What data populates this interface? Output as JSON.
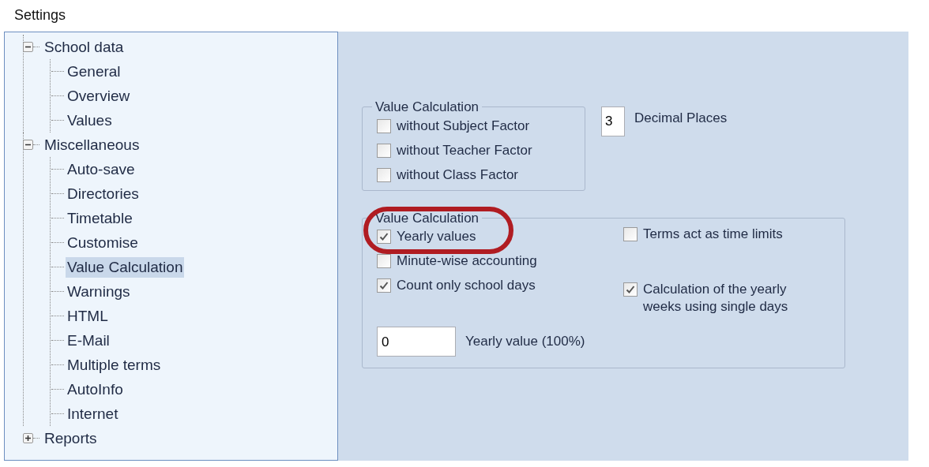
{
  "window": {
    "title": "Settings"
  },
  "tree": [
    {
      "label": "School data",
      "expanded": true,
      "selected": false,
      "children": [
        {
          "label": "General",
          "selected": false
        },
        {
          "label": "Overview",
          "selected": false
        },
        {
          "label": "Values",
          "selected": false
        }
      ]
    },
    {
      "label": "Miscellaneous",
      "expanded": true,
      "selected": false,
      "children": [
        {
          "label": "Auto-save",
          "selected": false
        },
        {
          "label": "Directories",
          "selected": false
        },
        {
          "label": "Timetable",
          "selected": false
        },
        {
          "label": "Customise",
          "selected": false
        },
        {
          "label": "Value Calculation",
          "selected": true
        },
        {
          "label": "Warnings",
          "selected": false
        },
        {
          "label": "HTML",
          "selected": false
        },
        {
          "label": "E-Mail",
          "selected": false
        },
        {
          "label": "Multiple terms",
          "selected": false
        },
        {
          "label": "AutoInfo",
          "selected": false
        },
        {
          "label": "Internet",
          "selected": false
        }
      ]
    },
    {
      "label": "Reports",
      "expanded": false,
      "selected": false
    }
  ],
  "factors_group": {
    "title": "Value Calculation",
    "options": [
      {
        "label": "without Subject Factor",
        "checked": false
      },
      {
        "label": "without Teacher Factor",
        "checked": false
      },
      {
        "label": "without Class Factor",
        "checked": false
      }
    ]
  },
  "decimal_places": {
    "value": "3",
    "label": "Decimal Places"
  },
  "values_group": {
    "title": "Value Calculation",
    "left_options": [
      {
        "label": "Yearly values",
        "checked": true,
        "highlighted": true
      },
      {
        "label": "Minute-wise accounting",
        "checked": false,
        "highlighted": false
      },
      {
        "label": "Count only school days",
        "checked": true,
        "highlighted": false
      }
    ],
    "right_options": [
      {
        "label": "Terms act as time limits",
        "checked": false
      },
      {
        "label": "Calculation of the yearly weeks using single days",
        "checked": true
      }
    ],
    "yearly_value": {
      "value": "0",
      "label": "Yearly value (100%)"
    }
  }
}
